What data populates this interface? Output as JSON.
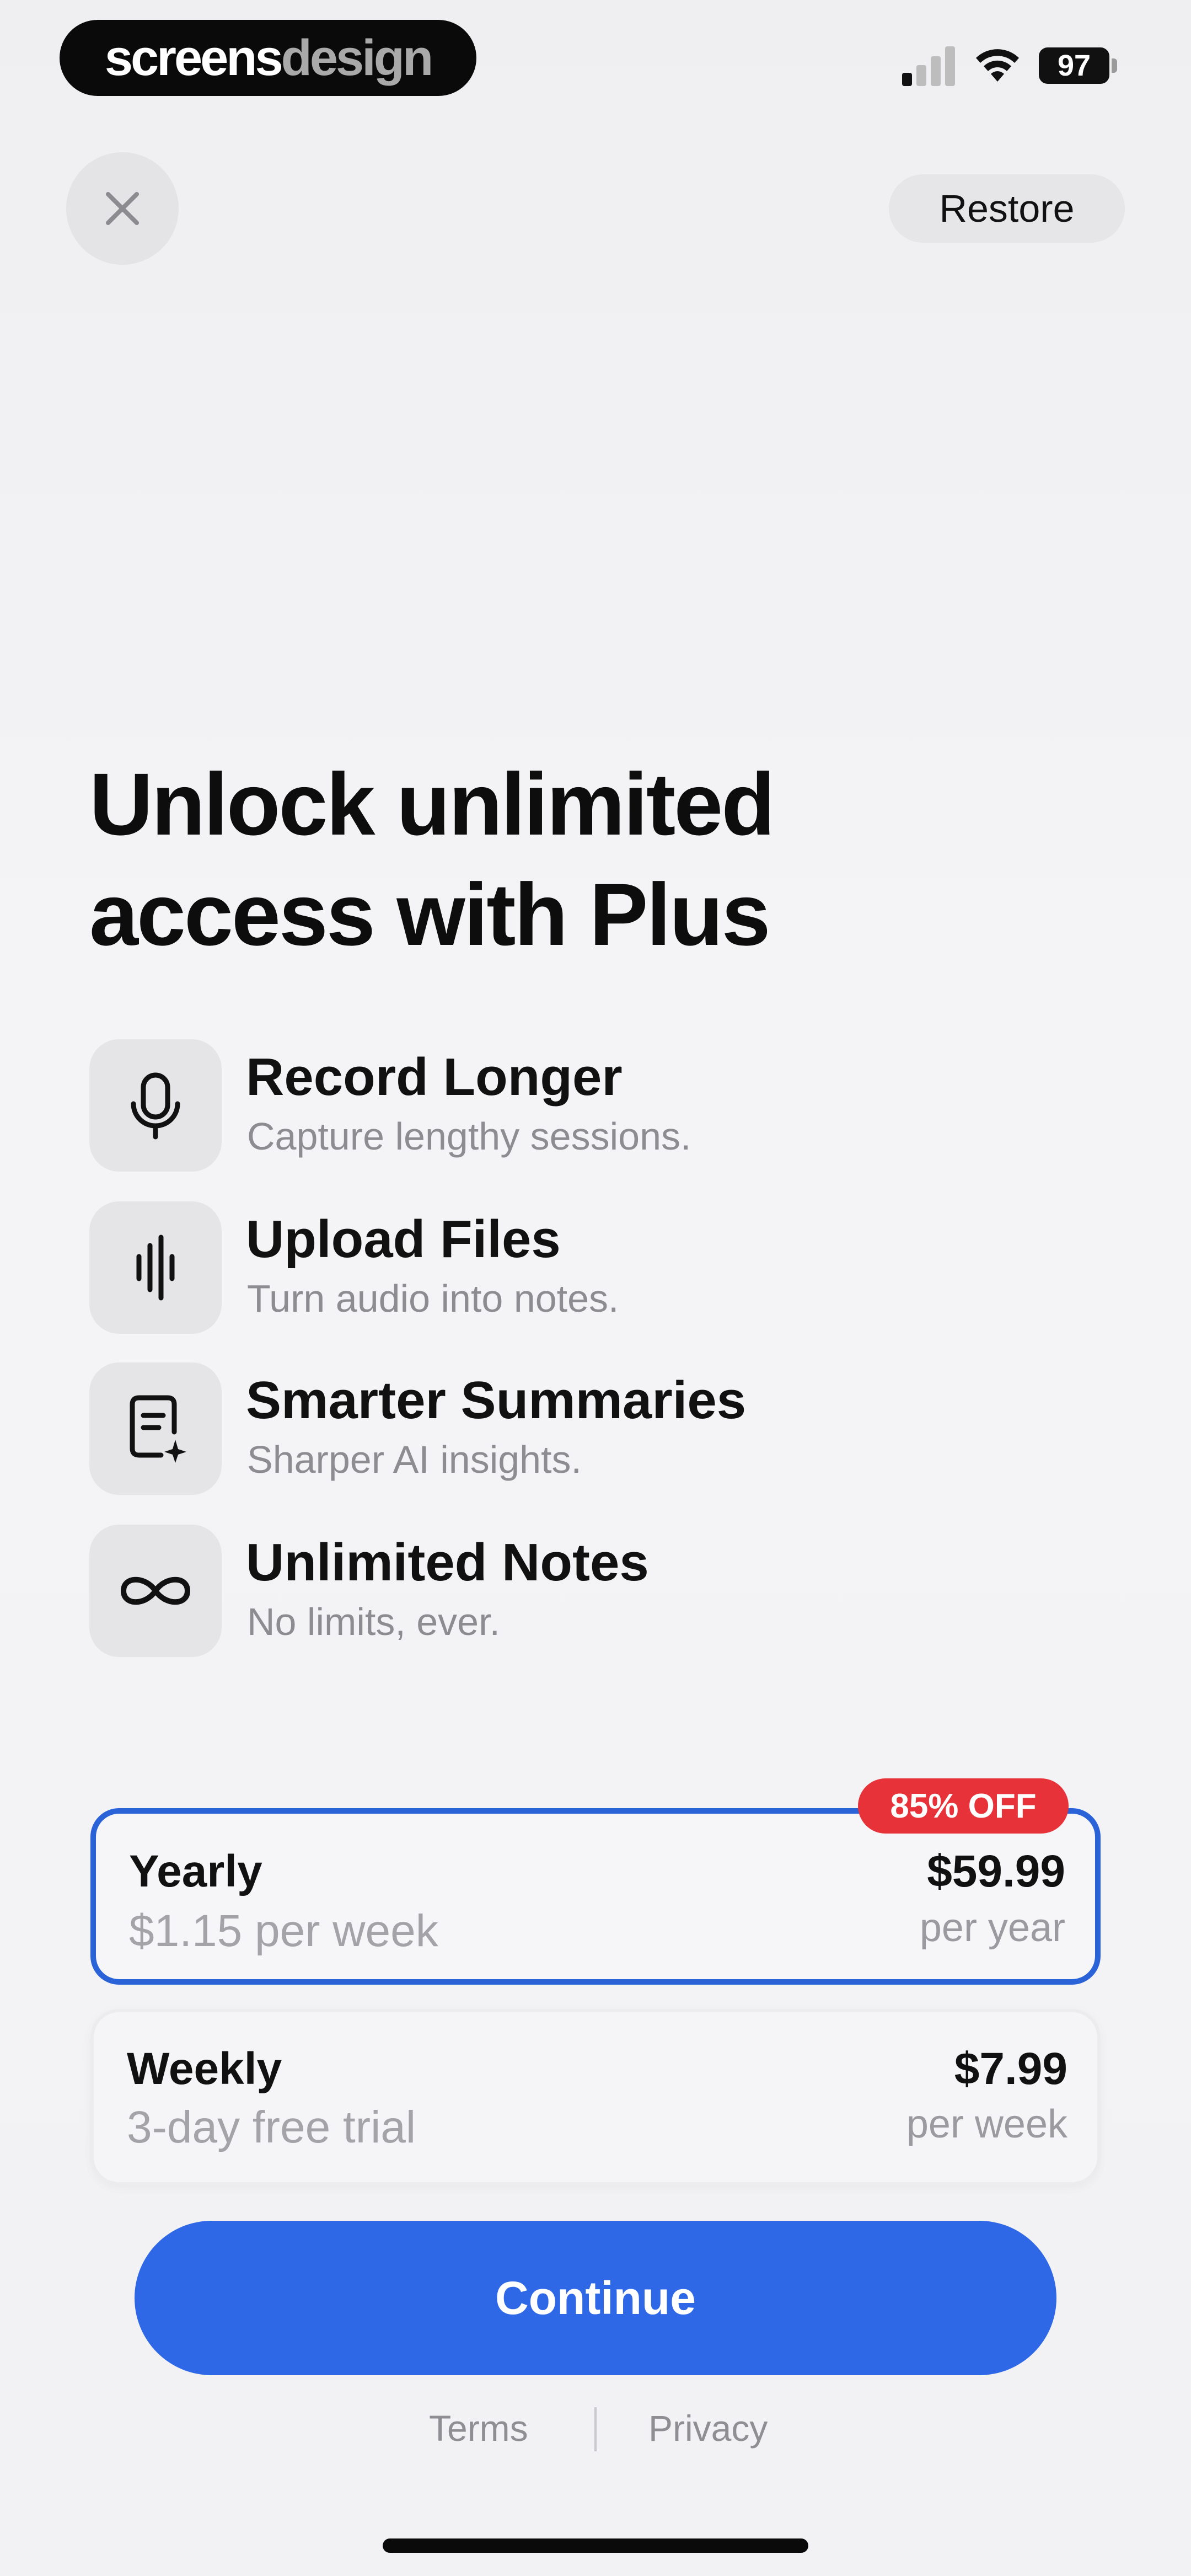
{
  "status_bar": {
    "watermark_part1": "screens",
    "watermark_part2": "design",
    "battery": "97"
  },
  "header": {
    "restore_label": "Restore",
    "close_icon": "close-icon"
  },
  "headline": {
    "line1": "Unlock unlimited",
    "line2": "access with Plus"
  },
  "features": [
    {
      "icon": "microphone-icon",
      "title": "Record Longer",
      "subtitle": "Capture lengthy sessions."
    },
    {
      "icon": "waveform-icon",
      "title": "Upload Files",
      "subtitle": "Turn audio into notes."
    },
    {
      "icon": "note-sparkle-icon",
      "title": "Smarter Summaries",
      "subtitle": "Sharper AI insights."
    },
    {
      "icon": "infinity-icon",
      "title": "Unlimited Notes",
      "subtitle": "No limits, ever."
    }
  ],
  "plans": [
    {
      "name": "Yearly",
      "subtitle": "$1.15 per week",
      "price": "$59.99",
      "period": "per year",
      "badge": "85% OFF",
      "selected": true
    },
    {
      "name": "Weekly",
      "subtitle": "3-day free trial",
      "price": "$7.99",
      "period": "per week",
      "selected": false
    }
  ],
  "continue_label": "Continue",
  "footer": {
    "terms": "Terms",
    "privacy": "Privacy"
  },
  "colors": {
    "accent": "#2f68e6",
    "selected_border": "#2a62d8",
    "badge": "#e8323a"
  }
}
